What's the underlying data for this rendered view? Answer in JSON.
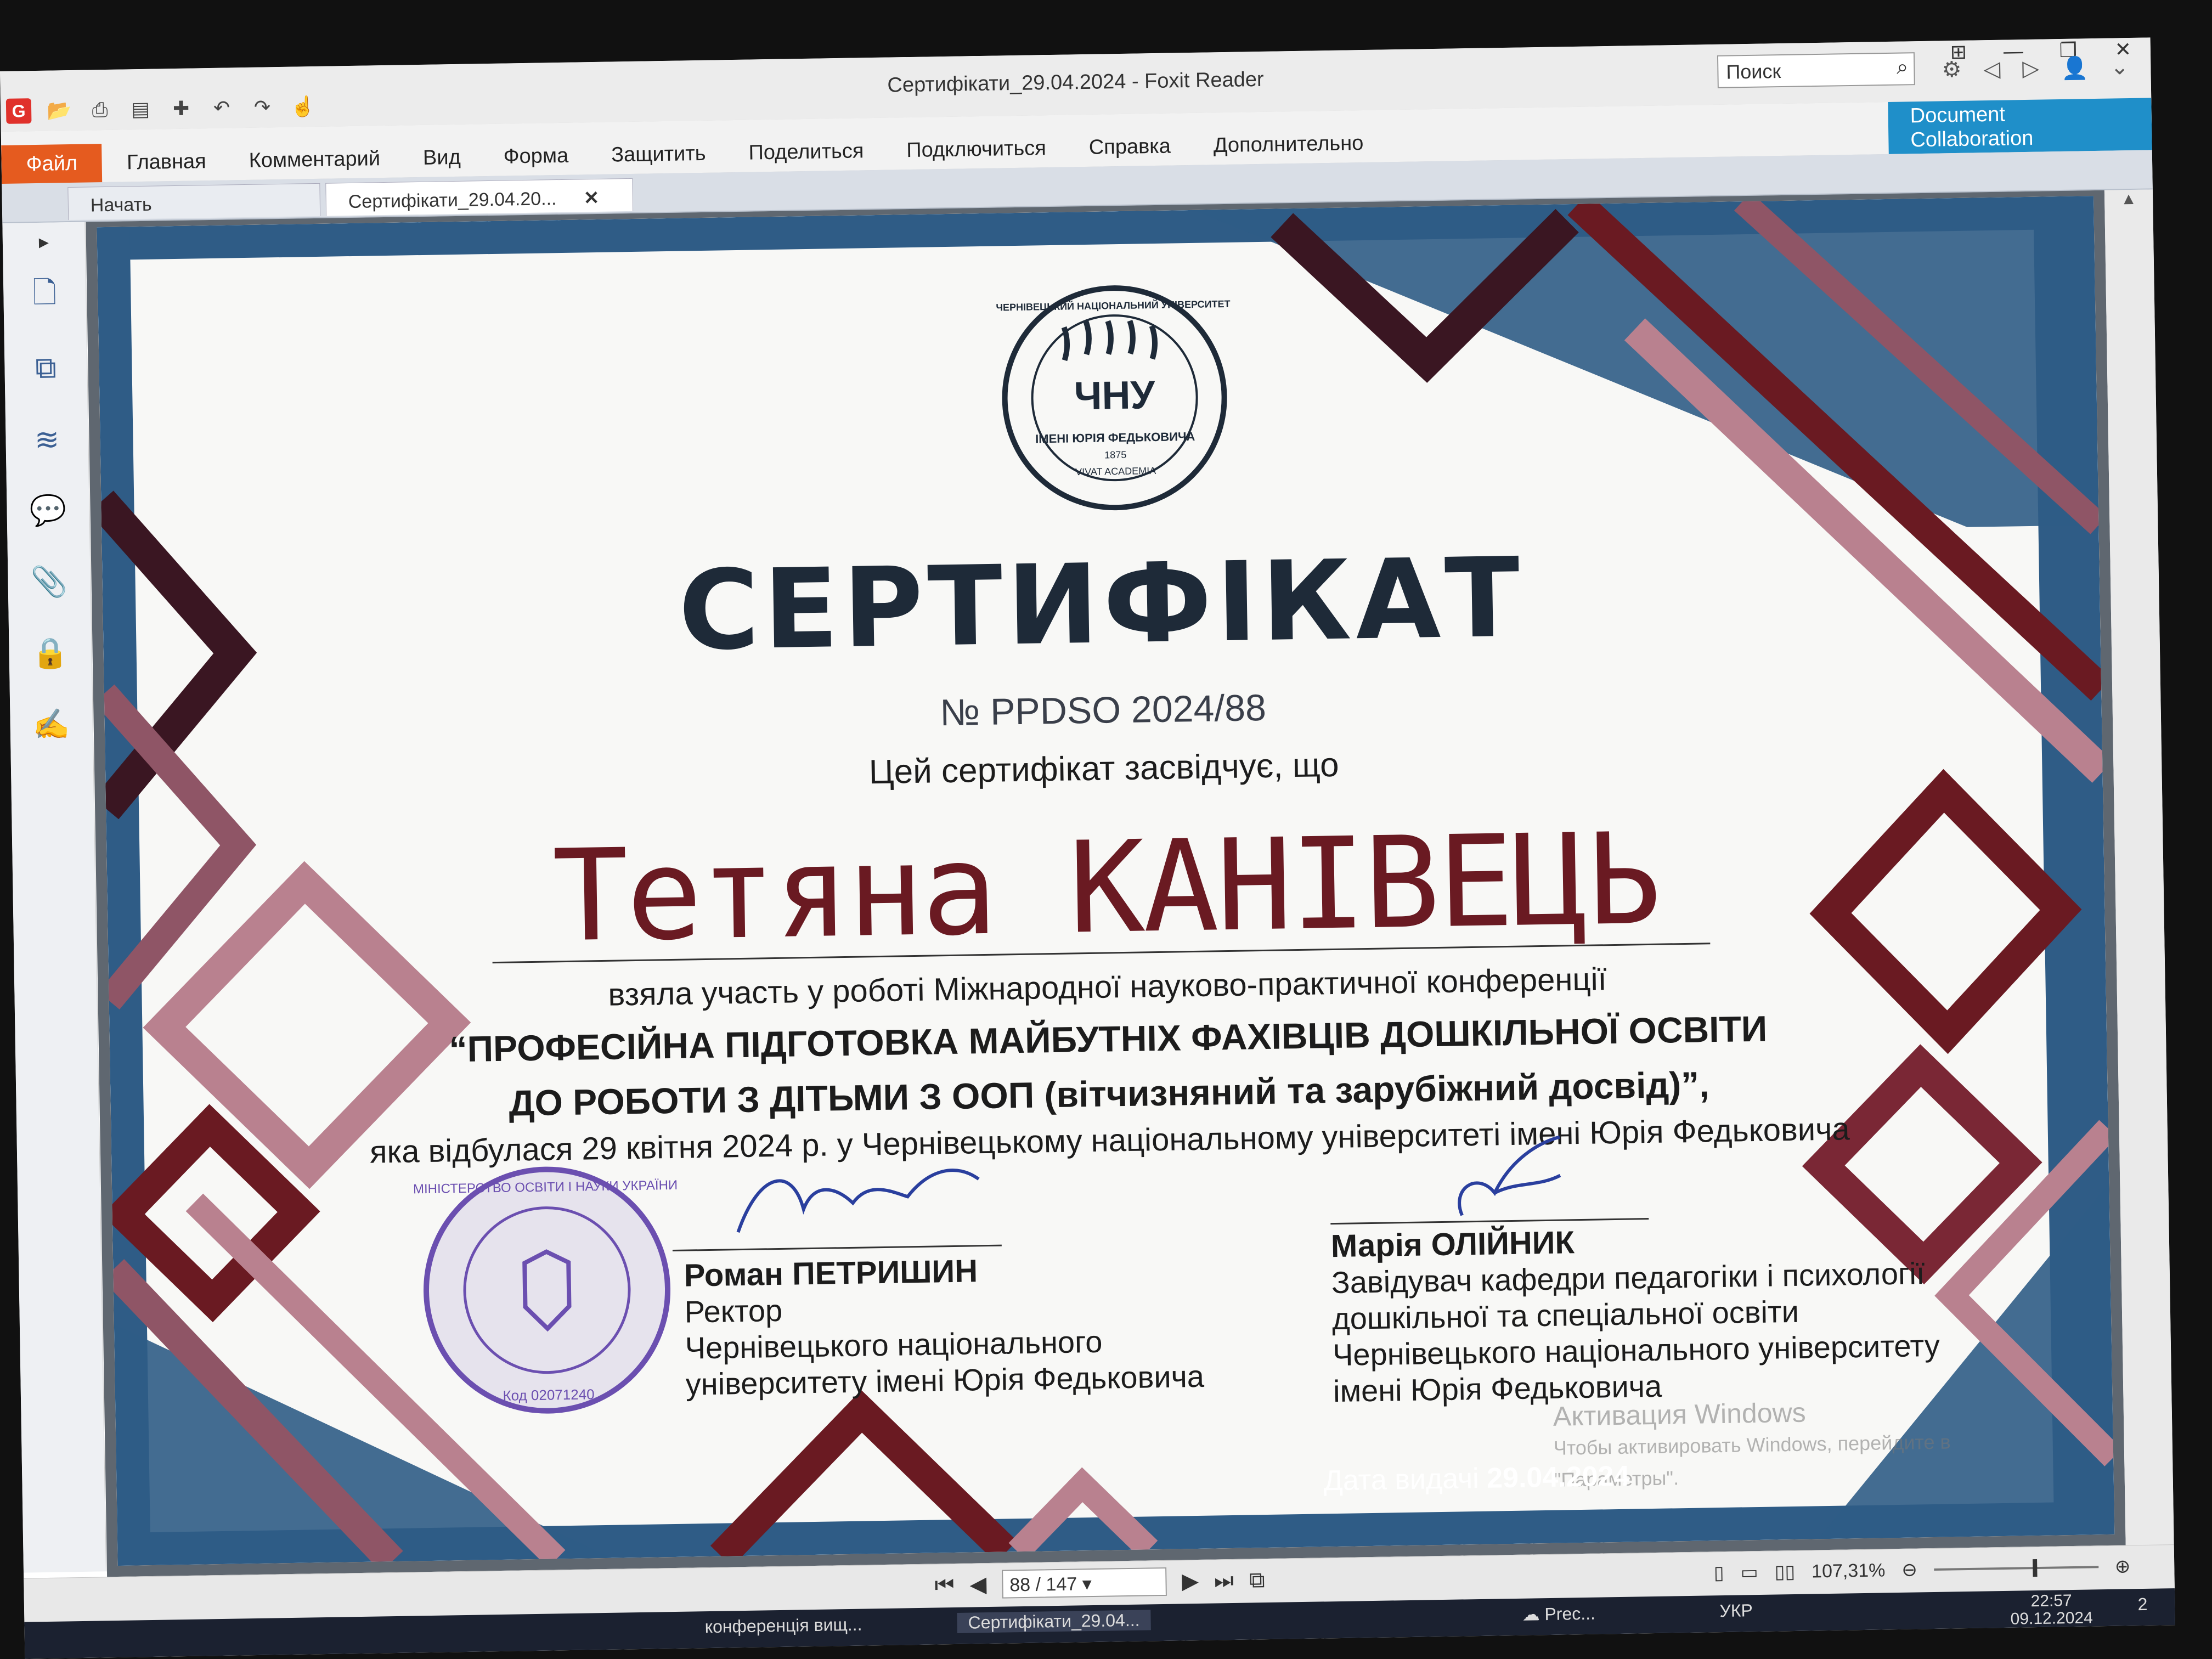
{
  "window": {
    "title": "Сертифікати_29.04.2024 - Foxit Reader",
    "controls": [
      "⊞",
      "—",
      "❐",
      "✕"
    ]
  },
  "quick_access": {
    "logo": "G",
    "icons": [
      "open-folder-icon",
      "print-icon",
      "properties-icon",
      "new-icon",
      "undo-icon",
      "redo-icon",
      "hand-tool-icon"
    ]
  },
  "ribbon": {
    "file_label": "Файл",
    "menu": [
      "Главная",
      "Комментарий",
      "Вид",
      "Форма",
      "Защитить",
      "Поделиться",
      "Подключиться",
      "Справка",
      "Дополнительно"
    ],
    "search_placeholder": "Поиск",
    "doc_collab_line1": "Document",
    "doc_collab_line2": "Collaboration"
  },
  "tabs": {
    "start": "Начать",
    "active": "Сертифікати_29.04.20...",
    "close": "✕"
  },
  "certificate": {
    "seal_text_top": "ЧЕРНІВЕЦЬКИЙ НАЦІОНАЛЬНИЙ УНІВЕРСИТЕТ",
    "seal_text_bottom": "ІМЕНІ ЮРІЯ ФЕДЬКОВИЧА",
    "seal_year": "1875",
    "seal_motto": "VIVAT ACADEMIA",
    "seal_abbr": "ЧНУ",
    "title": "СЕРТИФІКАТ",
    "number": "№ PPDSO 2024/88",
    "intro": "Цей сертифікат засвідчує, що",
    "name": "Тетяна  КАНІВЕЦЬ",
    "line1": "взяла участь у роботі Міжнародної науково-практичної конференції",
    "line2": "“ПРОФЕСІЙНА ПІДГОТОВКА МАЙБУТНІХ ФАХІВЦІВ ДОШКІЛЬНОЇ ОСВІТИ",
    "line3": "ДО РОБОТИ З ДІТЬМИ З ООП (вітчизняний та зарубіжний досвід)”,",
    "line4": "яка відбулася 29 квітня 2024 р. у Чернівецькому національному університеті імені Юрія Федьковича",
    "signer1": {
      "name": "Роман ПЕТРИШИН",
      "role1": "Ректор",
      "role2": "Чернівецького національного",
      "role3": "університету імені Юрія Федьковича"
    },
    "signer2": {
      "name": "Марія ОЛІЙНИК",
      "role1": "Завідувач кафедри педагогіки і психології",
      "role2": "дошкільної та спеціальної освіти",
      "role3": "Чернівецького національного університету",
      "role4": "імені Юрія Федьковича"
    },
    "stamp_text": "МІНІСТЕРСТВО ОСВІТИ І НАУКИ УКРАЇНИ",
    "stamp_code": "Код 02071240",
    "date_label": "Дата видачі",
    "date_value": "29.04.2024"
  },
  "watermark": {
    "line1": "Активация Windows",
    "line2": "Чтобы активировать Windows, перейдите в",
    "line3": "\"Параметры\"."
  },
  "statusbar": {
    "page": "88 / 147",
    "zoom": "107,31%"
  },
  "taskbar": {
    "item1": "конференція вищ...",
    "item2": "Сертифікати_29.04...",
    "weather": "Prec...",
    "lang": "УКР",
    "time": "22:57",
    "date": "09.12.2024",
    "notif": "2"
  },
  "colors": {
    "accent_orange": "#e55b1f",
    "collab_blue": "#1f8fc9",
    "cert_maroon": "#6a1a22",
    "cert_pink": "#b9818f",
    "cert_blue": "#2f5c86"
  }
}
